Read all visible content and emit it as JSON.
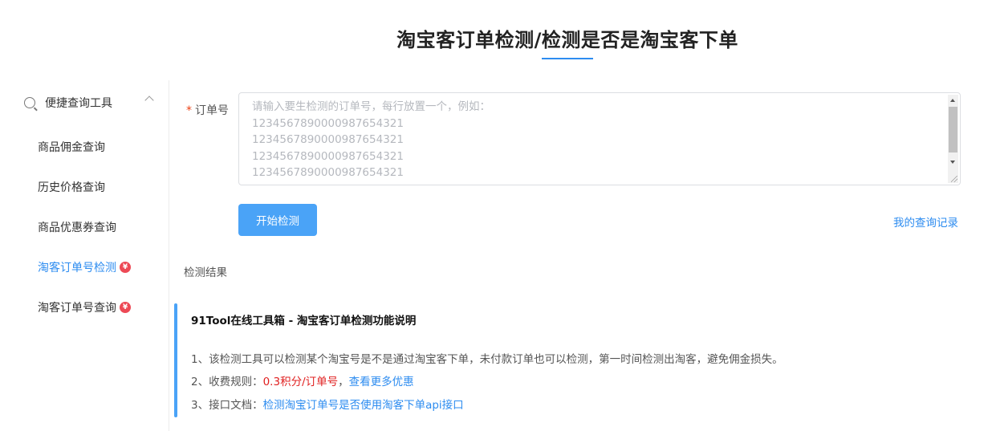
{
  "page": {
    "title": "淘宝客订单检测/检测是否是淘宝客下单"
  },
  "sidebar": {
    "group_label": "便捷查询工具",
    "items": [
      {
        "label": "商品佣金查询",
        "badge": ""
      },
      {
        "label": "历史价格查询",
        "badge": ""
      },
      {
        "label": "商品优惠券查询",
        "badge": ""
      },
      {
        "label": "淘客订单号检测",
        "badge": "¥"
      },
      {
        "label": "淘客订单号查询",
        "badge": "¥"
      }
    ],
    "active_index": 3
  },
  "form": {
    "required_mark": "*",
    "order_label": "订单号",
    "placeholder": "请输入要生检测的订单号，每行放置一个，例如：\n12345678900009876543 21\n12345678900009876543 21\n12345678900009876543 21\n12345678900009876543 21",
    "placeholder_lines": [
      "请输入要生检测的订单号，每行放置一个，例如：",
      "12345678900009876543​21",
      "12345678900009876543​21",
      "12345678900009876543​21",
      "12345678900009876543​21"
    ],
    "submit_label": "开始检测",
    "history_link": "我的查询记录"
  },
  "result": {
    "label": "检测结果"
  },
  "info": {
    "title": "91Tool在线工具箱 - 淘宝客订单检测功能说明",
    "line1": "1、该检测工具可以检测某个淘宝号是不是通过淘宝客下单，未付款订单也可以检测，第一时间检测出淘客，避免佣金损失。",
    "line2_prefix": "2、收费规则：",
    "line2_price": "0.3积分/订单号",
    "line2_sep": "，",
    "line2_link": "查看更多优惠",
    "line3_prefix": "3、接口文档：",
    "line3_link": "检测淘宝订单号是否使用淘客下单api接口"
  },
  "colors": {
    "accent": "#2d8cf0",
    "button": "#4aa3f7",
    "badge": "#ed4955",
    "price": "#e02020"
  }
}
